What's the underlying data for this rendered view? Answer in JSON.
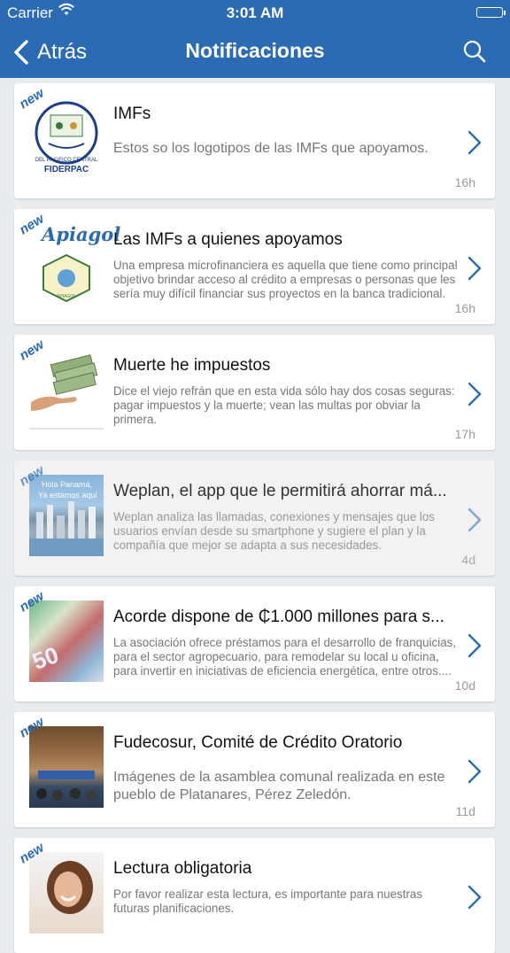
{
  "status_bar": {
    "carrier": "Carrier",
    "time": "3:01 AM"
  },
  "nav": {
    "back_label": "Atrás",
    "title": "Notificaciones"
  },
  "icons": {
    "back": "chevron-left-icon",
    "search": "search-icon",
    "disclosure": "chevron-right-icon",
    "wifi": "wifi-icon",
    "battery": "battery-icon"
  },
  "colors": {
    "primary": "#2a6bb4",
    "background": "#e9ecef"
  },
  "notifications": [
    {
      "badge": "new",
      "title": "IMFs",
      "description": "Estos so los logotipos de las IMFs que apoyamos.",
      "age": "16h",
      "thumbnail_text": [
        "FIDERPAC",
        "DEL PACIFICO CENTRAL"
      ]
    },
    {
      "badge": "new",
      "title": "Las IMFs a quienes apoyamos",
      "description": "Una empresa microfinanciera es aquella que tiene como principal objetivo brindar acceso al crédito a empresas o personas que les sería muy difícil financiar sus proyectos en la banca tradicional.",
      "age": "16h",
      "thumbnail_text": [
        "Apiagol",
        "APIAGOL"
      ]
    },
    {
      "badge": "new",
      "title": "Muerte he impuestos",
      "description": "Dice el viejo refrán que en esta vida sólo hay dos cosas seguras: pagar impuestos y la muerte; vean las multas por obviar la primera.",
      "age": "17h",
      "thumbnail_text": []
    },
    {
      "badge": "new",
      "title": "Weplan, el app que le permitirá ahorrar má...",
      "description": "Weplan analiza las llamadas, conexiones y mensajes que los usuarios envían desde su smartphone y sugiere el plan y la compañía que mejor se adapta a sus necesidades.",
      "age": "4d",
      "thumbnail_text": [
        "Hola Panamá,",
        "Ya estamos aquí"
      ]
    },
    {
      "badge": "new",
      "title": "Acorde dispone de ₵1.000 millones para s...",
      "description": "La asociación ofrece préstamos para el desarrollo de franquicias, para el sector agropecuario, para remodelar su local u oficina, para invertir en iniciativas de eficiencia energética, entre otros....",
      "age": "10d",
      "thumbnail_text": [
        "50"
      ]
    },
    {
      "badge": "new",
      "title": "Fudecosur, Comité de Crédito Oratorio",
      "description": "Imágenes de la asamblea comunal realizada en este pueblo de Platanares, Pérez Zeledón.",
      "age": "11d",
      "thumbnail_text": []
    },
    {
      "badge": "new",
      "title": "Lectura obligatoria",
      "description": "Por favor realizar esta lectura, es importante para nuestras futuras planificaciones.",
      "age": "",
      "thumbnail_text": []
    }
  ]
}
